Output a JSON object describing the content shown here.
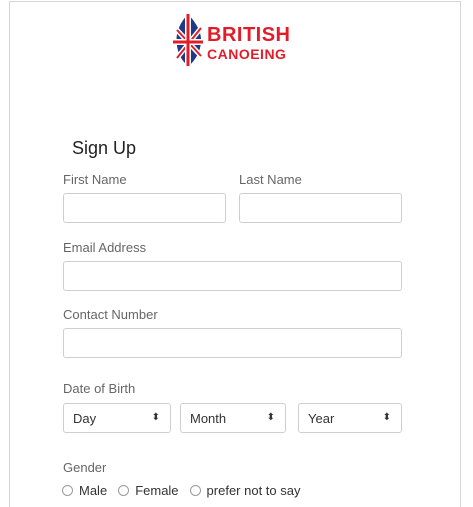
{
  "brand": {
    "line1": "BRITISH",
    "line2": "CANOEING",
    "logo_icon": "union-jack-flame-icon"
  },
  "form": {
    "title": "Sign Up",
    "first_name_label": "First Name",
    "last_name_label": "Last Name",
    "first_name_value": "",
    "last_name_value": "",
    "email_label": "Email Address",
    "email_value": "",
    "contact_label": "Contact Number",
    "contact_value": "",
    "dob_label": "Date of Birth",
    "dob_day": "Day",
    "dob_month": "Month",
    "dob_year": "Year",
    "select_arrow": "⬍",
    "gender_label": "Gender",
    "gender_options": [
      "Male",
      "Female",
      "prefer not to say"
    ]
  },
  "colors": {
    "brand_red": "#e11d2a",
    "brand_blue": "#1d3a8a",
    "border": "#cfcfcf"
  }
}
